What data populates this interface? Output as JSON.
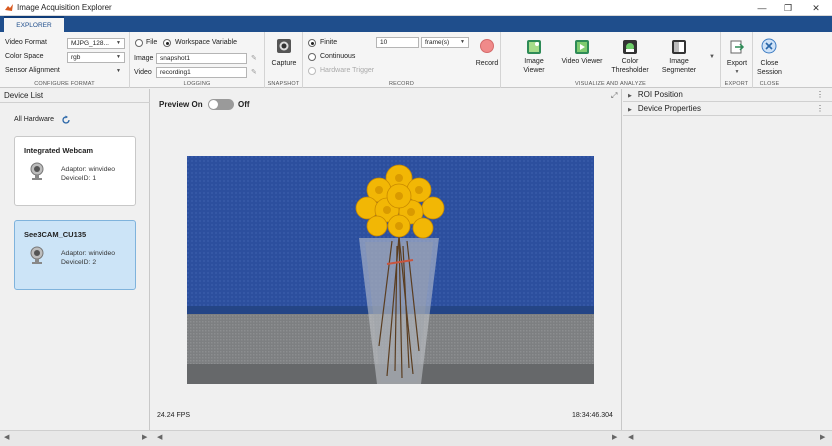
{
  "window": {
    "title": "Image Acquisition Explorer",
    "controls": {
      "minimize": "—",
      "maximize": "❐",
      "close": "✕"
    }
  },
  "tabs": [
    {
      "label": "EXPLORER",
      "active": true
    }
  ],
  "ribbon": {
    "configure_format": {
      "section_label": "CONFIGURE FORMAT",
      "video_format_label": "Video Format",
      "video_format_value": "MJPG_128...",
      "color_space_label": "Color Space",
      "color_space_value": "rgb",
      "sensor_alignment_label": "Sensor Alignment",
      "sensor_alignment_value": ""
    },
    "logging": {
      "section_label": "LOGGING",
      "file_option": "File",
      "workspace_option": "Workspace Variable",
      "selected": "Workspace Variable",
      "image_label": "Image",
      "image_value": "snapshot1",
      "video_label": "Video",
      "video_value": "recording1"
    },
    "snapshot": {
      "section_label": "SNAPSHOT",
      "capture_label": "Capture"
    },
    "record": {
      "section_label": "RECORD",
      "finite_option": "Finite",
      "continuous_option": "Continuous",
      "hardware_trigger_option": "Hardware Trigger",
      "frames_value": "10",
      "unit_value": "frame(s)",
      "record_label": "Record"
    },
    "visualize": {
      "section_label": "VISUALIZE AND ANALYZE",
      "apps": [
        {
          "label_line1": "Image",
          "label_line2": "Viewer"
        },
        {
          "label_line1": "Video Viewer",
          "label_line2": ""
        },
        {
          "label_line1": "Color",
          "label_line2": "Thresholder"
        },
        {
          "label_line1": "Image",
          "label_line2": "Segmenter"
        }
      ]
    },
    "export": {
      "section_label": "EXPORT",
      "export_label": "Export"
    },
    "close": {
      "section_label": "CLOSE",
      "close_line1": "Close",
      "close_line2": "Session"
    }
  },
  "device_list": {
    "title": "Device List",
    "filter_label": "All Hardware",
    "devices": [
      {
        "name": "Integrated Webcam",
        "adaptor": "Adaptor: winvideo",
        "device_id": "DeviceID: 1",
        "selected": false
      },
      {
        "name": "See3CAM_CU135",
        "adaptor": "Adaptor: winvideo",
        "device_id": "DeviceID: 2",
        "selected": true
      }
    ]
  },
  "preview": {
    "label": "Preview On",
    "off_label": "Off",
    "fps": "24.24 FPS",
    "timestamp": "18:34:46.304"
  },
  "properties": {
    "sections": [
      {
        "label": "ROI Position"
      },
      {
        "label": "Device Properties"
      }
    ]
  },
  "colors": {
    "tab_strip": "#1f4e8c",
    "selected_card": "#cce4f7",
    "record_button": "#f08a8a"
  }
}
